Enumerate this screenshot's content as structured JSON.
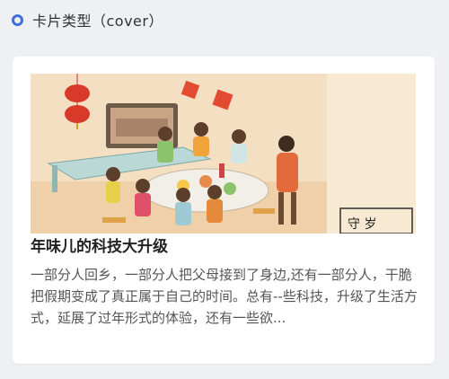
{
  "section": {
    "title": "卡片类型（cover）"
  },
  "card": {
    "cover_alt": "年味儿插画",
    "title": "年味儿的科技大升级",
    "description": "一部分人回乡，一部分人把父母接到了身边,还有一部分人，干脆把假期变成了真正属于自己的时间。总有--些科技，升级了生活方式，延展了过年形式的体验，还有一些欲..."
  },
  "colors": {
    "accent": "#3f6fd8",
    "card_bg": "#ffffff",
    "page_bg": "#eef0f3"
  }
}
